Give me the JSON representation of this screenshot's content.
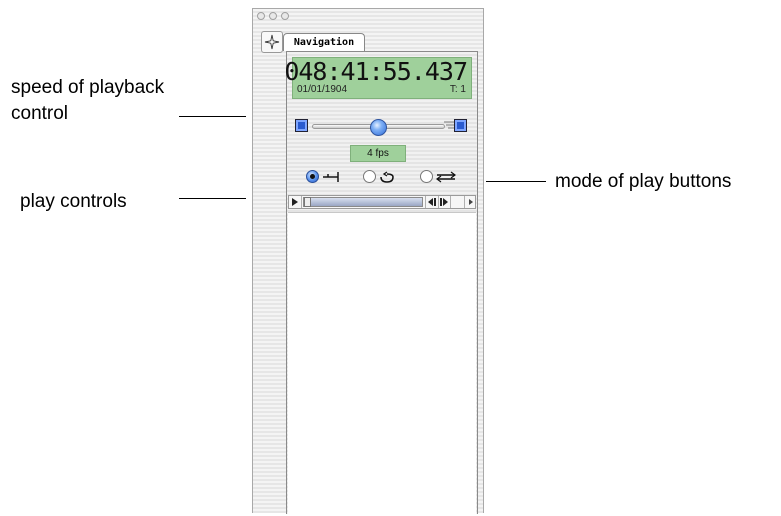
{
  "annotations": {
    "speed_line1": "speed of playback",
    "speed_line2": "control",
    "play_controls": "play controls",
    "mode_buttons": "mode of play buttons"
  },
  "window": {
    "tab_label": "Navigation",
    "display": {
      "time": "048:41:55.437",
      "date": "01/01/1904",
      "track": "T: 1"
    },
    "speed": {
      "fps_label": "4 fps",
      "slider_value_fraction": 0.5
    },
    "play_modes": [
      {
        "name": "play-once",
        "selected": true
      },
      {
        "name": "loop",
        "selected": false
      },
      {
        "name": "back-and-forth",
        "selected": false
      }
    ],
    "playback_progress": 0.0
  },
  "colors": {
    "display_green": "#9fd09b",
    "accent_blue": "#2f6bd8"
  }
}
